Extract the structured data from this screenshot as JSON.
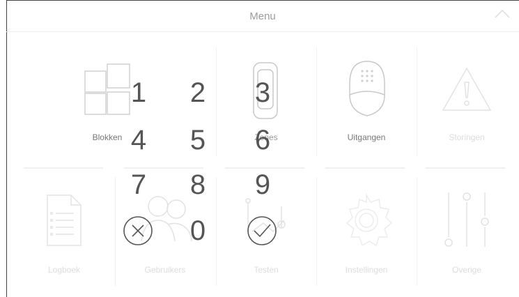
{
  "header": {
    "title": "Menu"
  },
  "tiles": {
    "row1": [
      "Blokken",
      "Zones",
      "Uitgangen",
      "Storingen"
    ],
    "row2": [
      "Logboek",
      "Gebruikers",
      "Testen",
      "Instellingen",
      "Overige"
    ]
  },
  "keypad": {
    "digits": [
      "1",
      "2",
      "3",
      "4",
      "5",
      "6",
      "7",
      "8",
      "9",
      "0"
    ],
    "cancel_icon": "cancel-x-icon",
    "confirm_icon": "confirm-check-icon"
  },
  "colors": {
    "key_text": "#555555",
    "faded_label": "#d6d6d6",
    "active_label": "#777777"
  }
}
